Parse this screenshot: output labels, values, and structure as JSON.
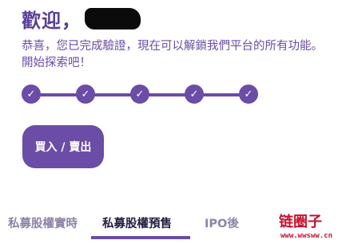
{
  "header": {
    "welcome_text": "歡迎，"
  },
  "message": "恭喜，您已完成驗證，現在可以解鎖我們平台的所有功能。開始探索吧！",
  "stepper": {
    "steps": [
      {
        "completed": true,
        "icon": "check-icon"
      },
      {
        "completed": true,
        "icon": "check-icon"
      },
      {
        "completed": true,
        "icon": "check-icon"
      },
      {
        "completed": true,
        "icon": "check-icon"
      },
      {
        "completed": true,
        "icon": "check-icon"
      }
    ]
  },
  "buy_sell_button": {
    "label": "買入 / 賣出"
  },
  "tabs": [
    {
      "label": "私募股權實時",
      "active": false
    },
    {
      "label": "私募股權預售",
      "active": true
    },
    {
      "label": "IPO後",
      "active": false
    }
  ],
  "watermark": {
    "logo_text": "链圈子",
    "url_text": "www.wwsww.cn"
  },
  "colors": {
    "accent": "#6b4ca6",
    "title": "#5a3f98",
    "tab_active": "#232041",
    "tab_inactive": "#8e83a8",
    "watermark": "#c8102e"
  }
}
